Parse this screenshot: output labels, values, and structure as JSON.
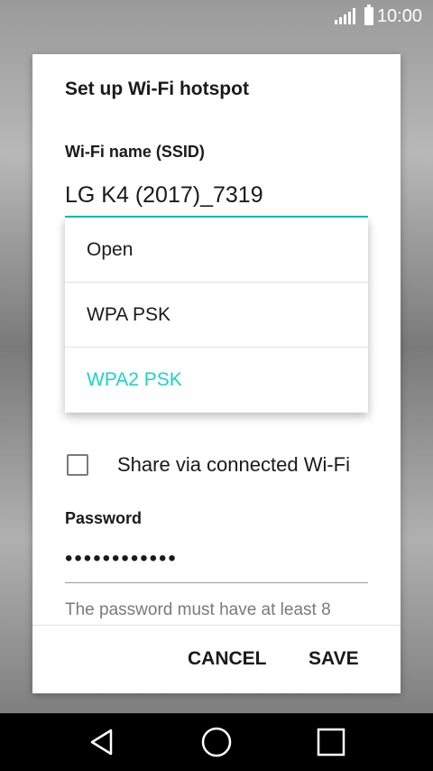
{
  "status_bar": {
    "time": "10:00"
  },
  "dialog": {
    "title": "Set up Wi-Fi hotspot",
    "ssid_label": "Wi-Fi name (SSID)",
    "ssid_value": "LG K4 (2017)_7319",
    "security_options": [
      {
        "label": "Open",
        "selected": false
      },
      {
        "label": "WPA PSK",
        "selected": false
      },
      {
        "label": "WPA2 PSK",
        "selected": true
      }
    ],
    "share_label": "Share via connected Wi-Fi",
    "share_checked": false,
    "password_label": "Password",
    "password_value": "••••••••••••",
    "hint": "The password must have at least 8",
    "cancel_label": "CANCEL",
    "save_label": "SAVE"
  },
  "colors": {
    "accent": "#19d4c4",
    "text": "#1a1a1a",
    "hint": "#7a7a7a"
  },
  "nav_icons": [
    "back-icon",
    "home-icon",
    "recents-icon"
  ]
}
